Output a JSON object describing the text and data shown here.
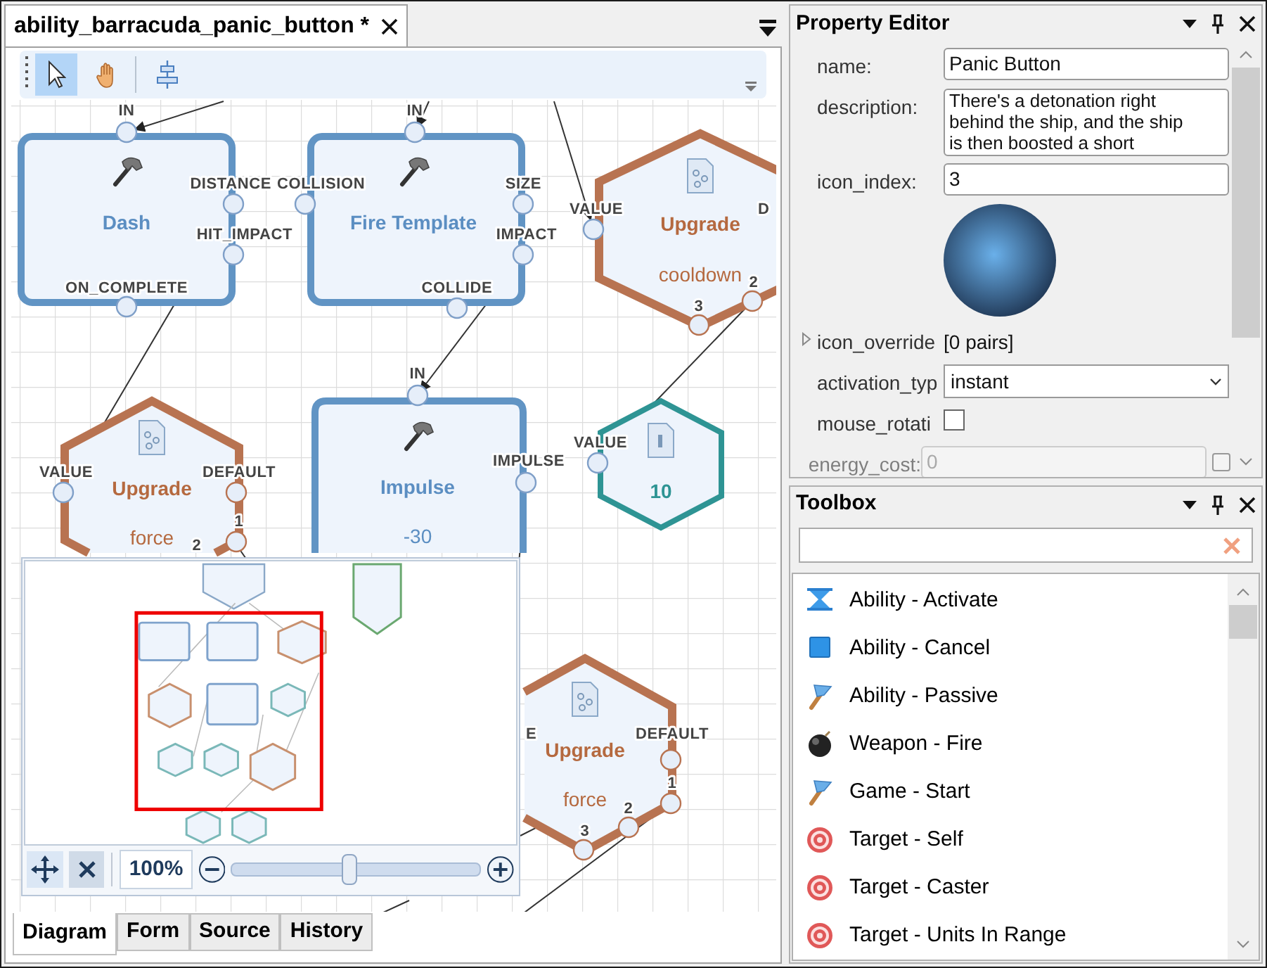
{
  "document_tab": {
    "title": "ability_barracuda_panic_button *"
  },
  "toolbar": {
    "tools": [
      {
        "kind": "pointer",
        "selected": true
      },
      {
        "kind": "pan",
        "selected": false
      },
      {
        "kind": "align",
        "selected": false
      }
    ]
  },
  "diagram": {
    "nodes": [
      {
        "kind": "action",
        "title": "Dash",
        "ports": [
          "IN",
          "DISTANCE",
          "HIT_IMPACT",
          "ON_COMPLETE"
        ]
      },
      {
        "kind": "action",
        "title": "Fire Template",
        "ports": [
          "IN",
          "COLLISION",
          "SIZE",
          "IMPACT",
          "COLLIDE"
        ]
      },
      {
        "kind": "upgrade",
        "title": "Upgrade",
        "subtitle": "cooldown",
        "ports": [
          "VALUE",
          "D",
          "3",
          "2"
        ]
      },
      {
        "kind": "upgrade",
        "title": "Upgrade",
        "subtitle": "force",
        "ports": [
          "VALUE",
          "DEFAULT",
          "1",
          "2"
        ]
      },
      {
        "kind": "action",
        "title": "Impulse",
        "subtitle": "-30",
        "ports": [
          "IN",
          "IMPULSE"
        ]
      },
      {
        "kind": "value",
        "title": "10",
        "ports": [
          "VALUE"
        ]
      },
      {
        "kind": "upgrade",
        "title": "Upgrade",
        "subtitle": "force",
        "ports": [
          "E",
          "DEFAULT",
          "1",
          "2",
          "3"
        ]
      }
    ]
  },
  "minimap": {
    "zoom": "100%",
    "slider": {
      "level": 0.47
    }
  },
  "view_tabs": [
    {
      "label": "Diagram",
      "selected": true
    },
    {
      "label": "Form",
      "selected": false
    },
    {
      "label": "Source",
      "selected": false
    },
    {
      "label": "History",
      "selected": false
    }
  ],
  "property_editor": {
    "title": "Property Editor",
    "rows": [
      {
        "kind": "text",
        "label": "name:",
        "value": "Panic Button",
        "disabled": false
      },
      {
        "kind": "textarea",
        "label": "description:",
        "value": "There's a detonation right behind the ship, and the ship is then boosted a short",
        "disabled": false
      },
      {
        "kind": "text",
        "label": "icon_index:",
        "value": "3",
        "disabled": false
      },
      {
        "kind": "image"
      },
      {
        "kind": "group",
        "label": "icon_override",
        "value": "[0 pairs]",
        "expanded": false
      },
      {
        "kind": "dropdown",
        "label": "activation_typ",
        "value": "instant",
        "disabled": false
      },
      {
        "kind": "checkbox",
        "label": "mouse_rotati",
        "checked": false,
        "disabled": false
      },
      {
        "kind": "text",
        "label": "energy_cost:",
        "value": "0",
        "disabled": true,
        "checked": false
      }
    ]
  },
  "toolbox": {
    "title": "Toolbox",
    "items": [
      {
        "kind": "hourglass",
        "label": "Ability - Activate"
      },
      {
        "kind": "square",
        "label": "Ability - Cancel"
      },
      {
        "kind": "flag",
        "label": "Ability - Passive"
      },
      {
        "kind": "bomb",
        "label": "Weapon - Fire"
      },
      {
        "kind": "flag",
        "label": "Game - Start"
      },
      {
        "kind": "target",
        "label": "Target - Self"
      },
      {
        "kind": "target",
        "label": "Target - Caster"
      },
      {
        "kind": "target",
        "label": "Target - Units In Range"
      }
    ]
  }
}
